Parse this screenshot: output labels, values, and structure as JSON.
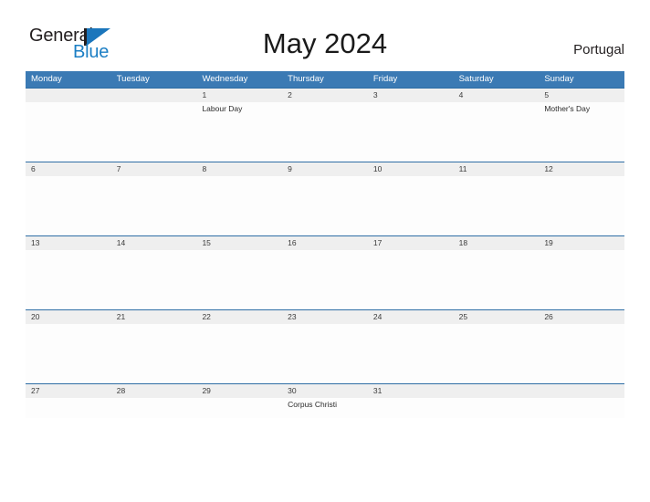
{
  "branding": {
    "logo_word_1": "General",
    "logo_word_2": "Blue",
    "logo_color_dark": "#231f20",
    "logo_color_blue": "#1b7ec4"
  },
  "header": {
    "title": "May 2024",
    "country": "Portugal"
  },
  "theme": {
    "header_blue": "#3b7ab4",
    "band_gray": "#efefef",
    "band_border": "#2e6da4"
  },
  "calendar": {
    "weekday_headers": [
      "Monday",
      "Tuesday",
      "Wednesday",
      "Thursday",
      "Friday",
      "Saturday",
      "Sunday"
    ],
    "weeks": [
      {
        "days": [
          {
            "date": "",
            "event": ""
          },
          {
            "date": "",
            "event": ""
          },
          {
            "date": "1",
            "event": "Labour Day"
          },
          {
            "date": "2",
            "event": ""
          },
          {
            "date": "3",
            "event": ""
          },
          {
            "date": "4",
            "event": ""
          },
          {
            "date": "5",
            "event": "Mother's Day"
          }
        ]
      },
      {
        "days": [
          {
            "date": "6",
            "event": ""
          },
          {
            "date": "7",
            "event": ""
          },
          {
            "date": "8",
            "event": ""
          },
          {
            "date": "9",
            "event": ""
          },
          {
            "date": "10",
            "event": ""
          },
          {
            "date": "11",
            "event": ""
          },
          {
            "date": "12",
            "event": ""
          }
        ]
      },
      {
        "days": [
          {
            "date": "13",
            "event": ""
          },
          {
            "date": "14",
            "event": ""
          },
          {
            "date": "15",
            "event": ""
          },
          {
            "date": "16",
            "event": ""
          },
          {
            "date": "17",
            "event": ""
          },
          {
            "date": "18",
            "event": ""
          },
          {
            "date": "19",
            "event": ""
          }
        ]
      },
      {
        "days": [
          {
            "date": "20",
            "event": ""
          },
          {
            "date": "21",
            "event": ""
          },
          {
            "date": "22",
            "event": ""
          },
          {
            "date": "23",
            "event": ""
          },
          {
            "date": "24",
            "event": ""
          },
          {
            "date": "25",
            "event": ""
          },
          {
            "date": "26",
            "event": ""
          }
        ]
      },
      {
        "days": [
          {
            "date": "27",
            "event": ""
          },
          {
            "date": "28",
            "event": ""
          },
          {
            "date": "29",
            "event": ""
          },
          {
            "date": "30",
            "event": "Corpus Christi"
          },
          {
            "date": "31",
            "event": ""
          },
          {
            "date": "",
            "event": ""
          },
          {
            "date": "",
            "event": ""
          }
        ]
      }
    ]
  }
}
